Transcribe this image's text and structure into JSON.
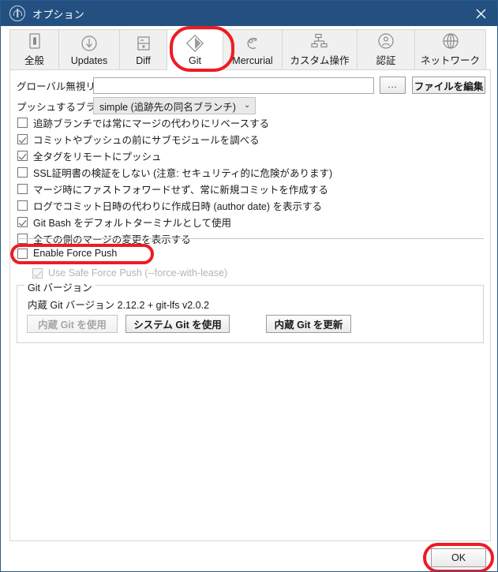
{
  "window": {
    "title": "オプション",
    "logo_icon": "sourcetree-logo-icon",
    "close_icon": "close-icon",
    "titlebar_color": "#235080"
  },
  "tabs": [
    {
      "label": "全般",
      "icon": "general-icon",
      "selected": false
    },
    {
      "label": "Updates",
      "icon": "update-icon",
      "selected": false
    },
    {
      "label": "Diff",
      "icon": "diff-icon",
      "selected": false
    },
    {
      "label": "Git",
      "icon": "git-icon",
      "selected": true
    },
    {
      "label": "Mercurial",
      "icon": "mercurial-icon",
      "selected": false
    },
    {
      "label": "カスタム操作",
      "icon": "custom-actions-icon",
      "selected": false
    },
    {
      "label": "認証",
      "icon": "authentication-icon",
      "selected": false
    },
    {
      "label": "ネットワーク",
      "icon": "network-icon",
      "selected": false
    }
  ],
  "form": {
    "global_ignore_label": "グローバル無視リスト:",
    "global_ignore_value": "",
    "global_ignore_placeholder": "",
    "browse_label": "...",
    "edit_file_label": "ファイルを編集",
    "push_branch_label": "プッシュするブランチ:",
    "push_branch_value": "simple (追跡先の同名ブランチ)",
    "chevron": "⌄"
  },
  "checkboxes": [
    {
      "label": "追跡ブランチでは常にマージの代わりにリベースする",
      "checked": false,
      "disabled": false
    },
    {
      "label": "コミットやプッシュの前にサブモジュールを調べる",
      "checked": true,
      "disabled": false
    },
    {
      "label": "全タグをリモートにプッシュ",
      "checked": true,
      "disabled": false
    },
    {
      "label": "SSL証明書の検証をしない (注意: セキュリティ的に危険があります)",
      "checked": false,
      "disabled": false
    },
    {
      "label": "マージ時にファストフォワードせず、常に新規コミットを作成する",
      "checked": false,
      "disabled": false
    },
    {
      "label": "ログでコミット日時の代わりに作成日時 (author date) を表示する",
      "checked": false,
      "disabled": false
    },
    {
      "label": "Git Bash をデフォルトターミナルとして使用",
      "checked": true,
      "disabled": false
    },
    {
      "label": "全ての側のマージの変更を表示する",
      "checked": false,
      "disabled": false
    }
  ],
  "force_push": {
    "enable_label": "Enable Force Push",
    "enable_checked": false,
    "safe_label": "Use Safe Force Push (--force-with-lease)",
    "safe_checked": true,
    "safe_disabled": true
  },
  "git_version": {
    "group_title": "Git バージョン",
    "version_text": "内蔵 Git バージョン 2.12.2 + git-lfs v2.0.2",
    "use_embedded_label": "内蔵 Git を使用",
    "use_embedded_disabled": true,
    "use_system_label": "システム Git を使用",
    "update_embedded_label": "内蔵 Git を更新"
  },
  "footer": {
    "ok_label": "OK"
  },
  "annotations": {
    "color": "#ed1c24",
    "targets": [
      "git-tab",
      "enable-force-push-checkbox",
      "ok-button"
    ]
  }
}
